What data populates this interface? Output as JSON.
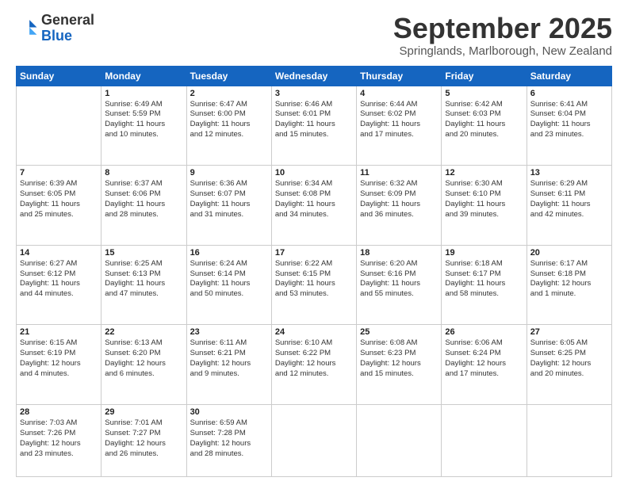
{
  "header": {
    "logo_general": "General",
    "logo_blue": "Blue",
    "month_title": "September 2025",
    "location": "Springlands, Marlborough, New Zealand"
  },
  "days_of_week": [
    "Sunday",
    "Monday",
    "Tuesday",
    "Wednesday",
    "Thursday",
    "Friday",
    "Saturday"
  ],
  "weeks": [
    [
      {
        "day": "",
        "info": ""
      },
      {
        "day": "1",
        "info": "Sunrise: 6:49 AM\nSunset: 5:59 PM\nDaylight: 11 hours\nand 10 minutes."
      },
      {
        "day": "2",
        "info": "Sunrise: 6:47 AM\nSunset: 6:00 PM\nDaylight: 11 hours\nand 12 minutes."
      },
      {
        "day": "3",
        "info": "Sunrise: 6:46 AM\nSunset: 6:01 PM\nDaylight: 11 hours\nand 15 minutes."
      },
      {
        "day": "4",
        "info": "Sunrise: 6:44 AM\nSunset: 6:02 PM\nDaylight: 11 hours\nand 17 minutes."
      },
      {
        "day": "5",
        "info": "Sunrise: 6:42 AM\nSunset: 6:03 PM\nDaylight: 11 hours\nand 20 minutes."
      },
      {
        "day": "6",
        "info": "Sunrise: 6:41 AM\nSunset: 6:04 PM\nDaylight: 11 hours\nand 23 minutes."
      }
    ],
    [
      {
        "day": "7",
        "info": "Sunrise: 6:39 AM\nSunset: 6:05 PM\nDaylight: 11 hours\nand 25 minutes."
      },
      {
        "day": "8",
        "info": "Sunrise: 6:37 AM\nSunset: 6:06 PM\nDaylight: 11 hours\nand 28 minutes."
      },
      {
        "day": "9",
        "info": "Sunrise: 6:36 AM\nSunset: 6:07 PM\nDaylight: 11 hours\nand 31 minutes."
      },
      {
        "day": "10",
        "info": "Sunrise: 6:34 AM\nSunset: 6:08 PM\nDaylight: 11 hours\nand 34 minutes."
      },
      {
        "day": "11",
        "info": "Sunrise: 6:32 AM\nSunset: 6:09 PM\nDaylight: 11 hours\nand 36 minutes."
      },
      {
        "day": "12",
        "info": "Sunrise: 6:30 AM\nSunset: 6:10 PM\nDaylight: 11 hours\nand 39 minutes."
      },
      {
        "day": "13",
        "info": "Sunrise: 6:29 AM\nSunset: 6:11 PM\nDaylight: 11 hours\nand 42 minutes."
      }
    ],
    [
      {
        "day": "14",
        "info": "Sunrise: 6:27 AM\nSunset: 6:12 PM\nDaylight: 11 hours\nand 44 minutes."
      },
      {
        "day": "15",
        "info": "Sunrise: 6:25 AM\nSunset: 6:13 PM\nDaylight: 11 hours\nand 47 minutes."
      },
      {
        "day": "16",
        "info": "Sunrise: 6:24 AM\nSunset: 6:14 PM\nDaylight: 11 hours\nand 50 minutes."
      },
      {
        "day": "17",
        "info": "Sunrise: 6:22 AM\nSunset: 6:15 PM\nDaylight: 11 hours\nand 53 minutes."
      },
      {
        "day": "18",
        "info": "Sunrise: 6:20 AM\nSunset: 6:16 PM\nDaylight: 11 hours\nand 55 minutes."
      },
      {
        "day": "19",
        "info": "Sunrise: 6:18 AM\nSunset: 6:17 PM\nDaylight: 11 hours\nand 58 minutes."
      },
      {
        "day": "20",
        "info": "Sunrise: 6:17 AM\nSunset: 6:18 PM\nDaylight: 12 hours\nand 1 minute."
      }
    ],
    [
      {
        "day": "21",
        "info": "Sunrise: 6:15 AM\nSunset: 6:19 PM\nDaylight: 12 hours\nand 4 minutes."
      },
      {
        "day": "22",
        "info": "Sunrise: 6:13 AM\nSunset: 6:20 PM\nDaylight: 12 hours\nand 6 minutes."
      },
      {
        "day": "23",
        "info": "Sunrise: 6:11 AM\nSunset: 6:21 PM\nDaylight: 12 hours\nand 9 minutes."
      },
      {
        "day": "24",
        "info": "Sunrise: 6:10 AM\nSunset: 6:22 PM\nDaylight: 12 hours\nand 12 minutes."
      },
      {
        "day": "25",
        "info": "Sunrise: 6:08 AM\nSunset: 6:23 PM\nDaylight: 12 hours\nand 15 minutes."
      },
      {
        "day": "26",
        "info": "Sunrise: 6:06 AM\nSunset: 6:24 PM\nDaylight: 12 hours\nand 17 minutes."
      },
      {
        "day": "27",
        "info": "Sunrise: 6:05 AM\nSunset: 6:25 PM\nDaylight: 12 hours\nand 20 minutes."
      }
    ],
    [
      {
        "day": "28",
        "info": "Sunrise: 7:03 AM\nSunset: 7:26 PM\nDaylight: 12 hours\nand 23 minutes."
      },
      {
        "day": "29",
        "info": "Sunrise: 7:01 AM\nSunset: 7:27 PM\nDaylight: 12 hours\nand 26 minutes."
      },
      {
        "day": "30",
        "info": "Sunrise: 6:59 AM\nSunset: 7:28 PM\nDaylight: 12 hours\nand 28 minutes."
      },
      {
        "day": "",
        "info": ""
      },
      {
        "day": "",
        "info": ""
      },
      {
        "day": "",
        "info": ""
      },
      {
        "day": "",
        "info": ""
      }
    ]
  ]
}
